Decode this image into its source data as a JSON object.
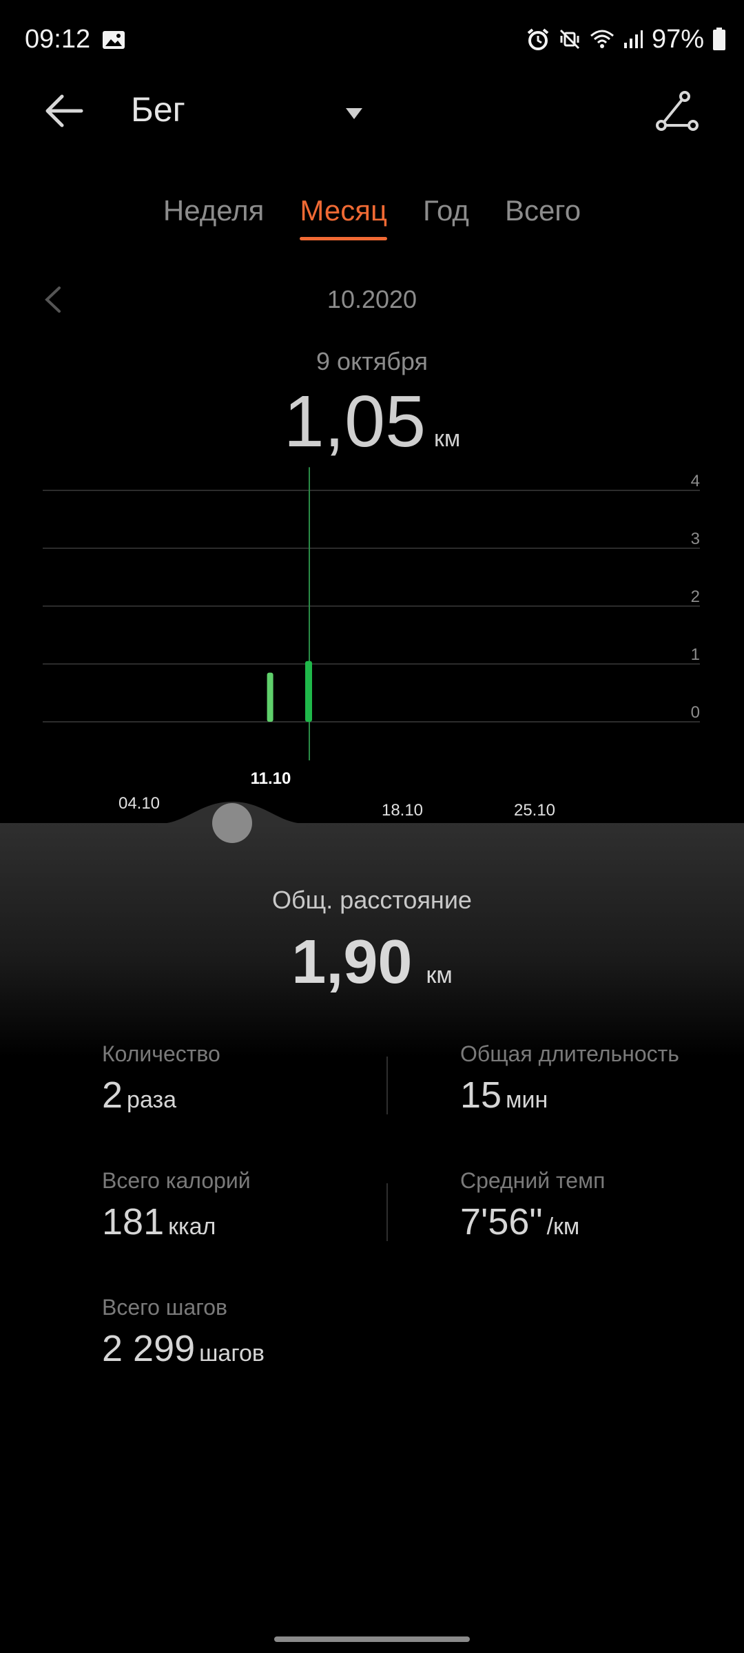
{
  "status_bar": {
    "time": "09:12",
    "battery": "97%",
    "icons": [
      "image-icon",
      "alarm-icon",
      "mute-icon",
      "wifi-icon",
      "signal-icon",
      "battery-icon"
    ]
  },
  "header": {
    "title": "Бег",
    "icons": [
      "back-arrow-icon",
      "dropdown-icon",
      "route-icon"
    ]
  },
  "tabs": [
    {
      "label": "Неделя",
      "active": false
    },
    {
      "label": "Месяц",
      "active": true
    },
    {
      "label": "Год",
      "active": false
    },
    {
      "label": "Всего",
      "active": false
    }
  ],
  "period": {
    "label": "10.2020",
    "selected_date": "9 октября",
    "selected_value": "1,05",
    "selected_unit": "км"
  },
  "chart_data": {
    "type": "bar",
    "x": [
      "04.10",
      "11.10",
      "18.10",
      "25.10"
    ],
    "y_ticks": [
      "0",
      "1",
      "2",
      "3",
      "4"
    ],
    "ylim": [
      0,
      4
    ],
    "series": [
      {
        "values": [
          {
            "day": 8,
            "value": 0.85
          },
          {
            "day": 9,
            "value": 1.05
          }
        ]
      }
    ],
    "selected_day": 9,
    "highlighted_tick": "11.10",
    "colors": {
      "bar_past": "#5fd06b",
      "bar_selected": "#1fb84a",
      "grid": "#2c2c2c",
      "cursor": "#2a8a46"
    }
  },
  "summary": {
    "total_label": "Общ. расстояние",
    "total_value": "1,90",
    "total_unit": "км",
    "stats": [
      {
        "label": "Количество",
        "value": "2",
        "unit": "раза"
      },
      {
        "label": "Общая длительность",
        "value": "15",
        "unit": "мин"
      },
      {
        "label": "Всего калорий",
        "value": "181",
        "unit": "ккал"
      },
      {
        "label": "Средний темп",
        "value": "7'56\"",
        "unit": "/км"
      },
      {
        "label": "Всего шагов",
        "value": "2 299",
        "unit": "шагов"
      }
    ]
  },
  "colors": {
    "accent": "#f06a34",
    "background": "#000000"
  }
}
